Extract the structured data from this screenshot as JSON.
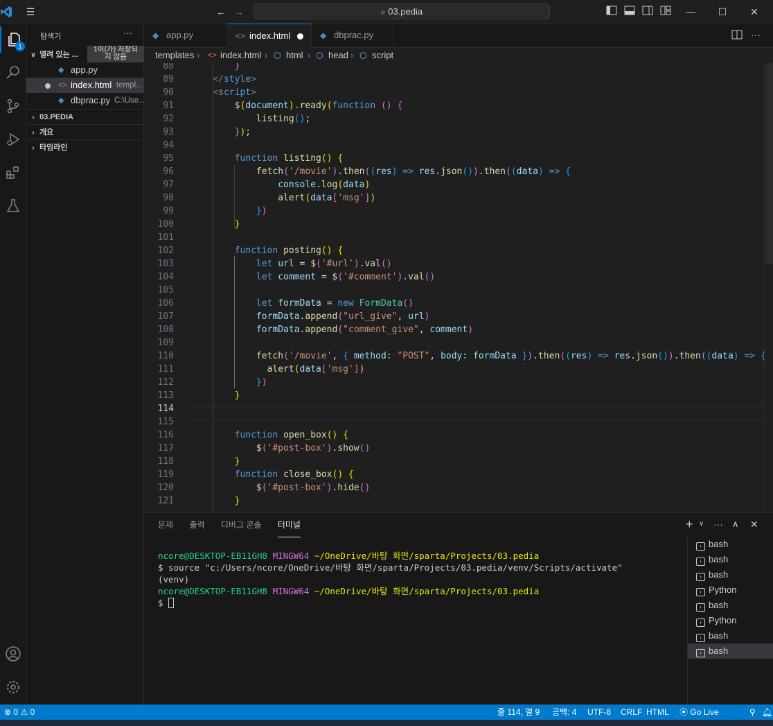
{
  "titlebar": {
    "search_text": "03.pedia"
  },
  "sidebar": {
    "title": "탐색기",
    "more": "···",
    "open_editors_label": "열려 있는 ...",
    "unsaved_tooltip_line1": "1이(가) 저장되",
    "unsaved_tooltip_line2": "지 않음",
    "files": [
      {
        "name": "app.py",
        "hint": "",
        "icon": "python-icon"
      },
      {
        "name": "index.html",
        "hint": "templ...",
        "icon": "html-icon"
      },
      {
        "name": "dbprac.py",
        "hint": "C:\\Use...",
        "icon": "python-icon"
      }
    ],
    "sections": [
      "03.PEDIA",
      "개요",
      "타임라인"
    ]
  },
  "activity": {
    "badge": "1"
  },
  "tabs": [
    {
      "label": "app.py",
      "icon": "python-icon"
    },
    {
      "label": "index.html",
      "icon": "html-icon"
    },
    {
      "label": "dbprac.py",
      "icon": "python-icon"
    }
  ],
  "breadcrumb": [
    "templates",
    "index.html",
    "html",
    "head",
    "script"
  ],
  "editor": {
    "current_line": "114",
    "lines": [
      "88",
      "89",
      "90",
      "91",
      "92",
      "93",
      "94",
      "95",
      "96",
      "97",
      "98",
      "99",
      "100",
      "101",
      "102",
      "103",
      "104",
      "105",
      "106",
      "107",
      "108",
      "109",
      "110",
      "111",
      "112",
      "113",
      "114",
      "115",
      "116",
      "117",
      "118",
      "119",
      "120",
      "121"
    ]
  },
  "panel": {
    "tabs": [
      "문제",
      "출력",
      "디버그 콘솔",
      "터미널"
    ],
    "terminal": {
      "prompt_user": "ncore@DESKTOP-EB11GH8",
      "prompt_env": "MINGW64",
      "prompt_path": "~/OneDrive/바탕 화면/sparta/Projects/03.pedia",
      "command": "$ source \"c:/Users/ncore/OneDrive/바탕 화면/sparta/Projects/03.pedia/venv/Scripts/activate\"",
      "venv": "(venv)",
      "dollar": "$"
    },
    "terminal_list": [
      "bash",
      "bash",
      "bash",
      "Python",
      "bash",
      "Python",
      "bash",
      "bash"
    ]
  },
  "status": {
    "errors": "0",
    "warnings": "0",
    "position": "줄 114, 열 9",
    "spaces": "공백: 4",
    "encoding": "UTF-8",
    "eol": "CRLF",
    "language": "HTML",
    "golive": "Go Live"
  },
  "colors": {
    "accent": "#007acc",
    "background": "#1f1f1f"
  }
}
